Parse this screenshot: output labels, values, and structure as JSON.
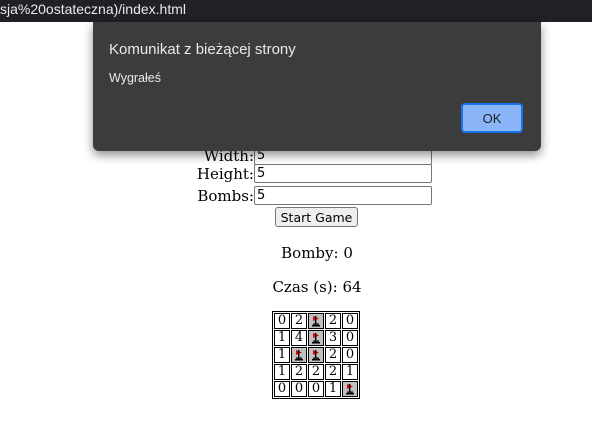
{
  "browser": {
    "url_fragment": "sja%20ostateczna)/index.html"
  },
  "form": {
    "width_label": "Width:",
    "width_value": "5",
    "height_label": "Height:",
    "height_value": "5",
    "bombs_label": "Bombs:",
    "bombs_value": "5",
    "start_label": "Start Game"
  },
  "status": {
    "bombs_text": "Bomby: 0",
    "time_text": "Czas (s): 64"
  },
  "board": {
    "rows": [
      [
        "0",
        "2",
        "F",
        "2",
        "0"
      ],
      [
        "1",
        "4",
        "F",
        "3",
        "0"
      ],
      [
        "1",
        "F",
        "F",
        "2",
        "0"
      ],
      [
        "1",
        "2",
        "2",
        "2",
        "1"
      ],
      [
        "0",
        "0",
        "0",
        "1",
        "F"
      ]
    ]
  },
  "dialog": {
    "title": "Komunikat z bieżącej strony",
    "message": "Wygrałeś",
    "ok_label": "OK",
    "ok_border_color": "#1a73e8",
    "ok_fill_color": "#8ab4f8"
  },
  "icons": {
    "flag": "flag-icon"
  }
}
